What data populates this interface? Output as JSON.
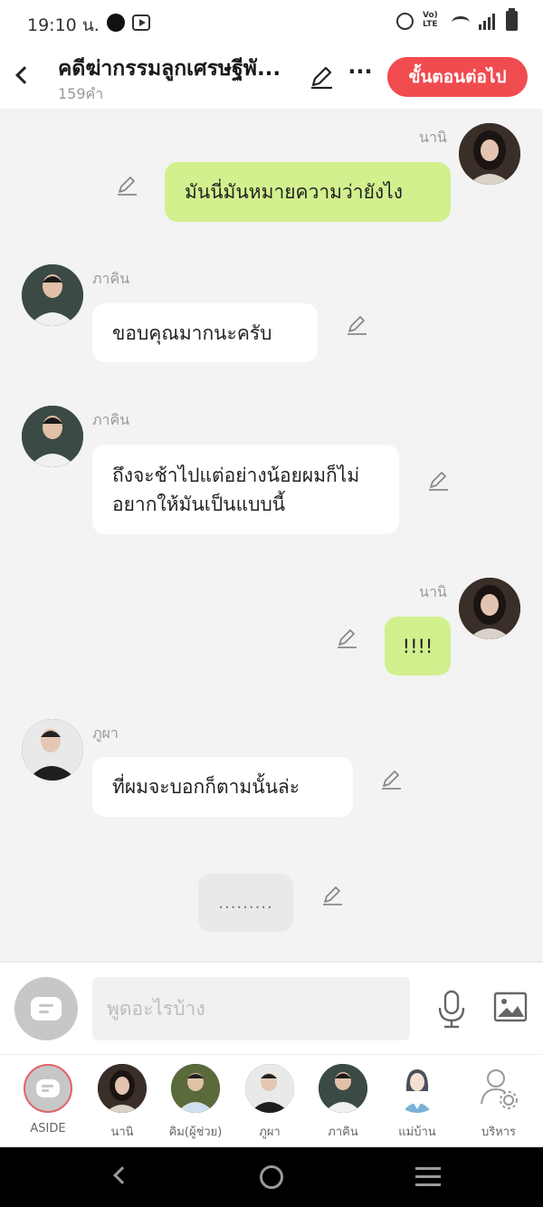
{
  "status_bar": {
    "time": "19:10 น.",
    "volte": "Vo) LTE"
  },
  "header": {
    "title": "คดีฆ่ากรรมลูกเศรษฐีพั...",
    "word_count": "159คำ",
    "next_button": "ขั้นตอนต่อไป",
    "more_label": "···",
    "accent_color": "#f04b4f"
  },
  "chat": {
    "messages": [
      {
        "side": "out",
        "sender": "นานิ",
        "text": "มันนี่มันหมายความว่ายังไง"
      },
      {
        "side": "in",
        "sender": "ภาคิน",
        "text": "ขอบคุณมากนะครับ"
      },
      {
        "side": "in",
        "sender": "ภาคิน",
        "text": "ถึงจะช้าไปแต่อย่างน้อยผมก็ไม่อยากให้มันเป็นแบบนี้"
      },
      {
        "side": "out",
        "sender": "นานิ",
        "text": "!!!!"
      },
      {
        "side": "in",
        "sender": "ภูผา",
        "text": "ที่ผมจะบอกก็ตามนั้นล่ะ"
      }
    ],
    "typing_text": ".........",
    "outgoing_color": "#d2f08e"
  },
  "input": {
    "placeholder": "พูดอะไรบ้าง"
  },
  "characters": [
    {
      "label": "ASIDE",
      "icon": "aside-chat-icon"
    },
    {
      "label": "นานิ"
    },
    {
      "label": "คิม(ผู้ช่วย)"
    },
    {
      "label": "ภูผา"
    },
    {
      "label": "ภาคิน"
    },
    {
      "label": "แม่บ้าน"
    },
    {
      "label": "บริหาร",
      "icon": "user-settings-icon"
    }
  ]
}
